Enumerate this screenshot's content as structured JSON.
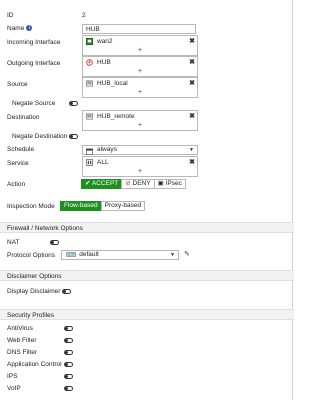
{
  "fields": {
    "id": {
      "label": "ID",
      "value": "2"
    },
    "name": {
      "label": "Name",
      "value": "HUB"
    },
    "incoming": {
      "label": "Incoming Interface",
      "items": [
        "wan2"
      ]
    },
    "outgoing": {
      "label": "Outgoing Interface",
      "items": [
        "HUB"
      ]
    },
    "source": {
      "label": "Source",
      "items": [
        "HUB_local"
      ]
    },
    "negate_source": {
      "label": "Negate Source"
    },
    "destination": {
      "label": "Destination",
      "items": [
        "HUB_remote"
      ]
    },
    "negate_destination": {
      "label": "Negate Destination"
    },
    "schedule": {
      "label": "Schedule",
      "value": "always"
    },
    "service": {
      "label": "Service",
      "items": [
        "ALL"
      ]
    },
    "action": {
      "label": "Action",
      "options": [
        "ACCEPT",
        "DENY",
        "IPsec"
      ],
      "selected": "ACCEPT"
    },
    "inspection_mode": {
      "label": "Inspection Mode",
      "options": [
        "Flow-based",
        "Proxy-based"
      ],
      "selected": "Flow-based"
    }
  },
  "firewall": {
    "title": "Firewall / Network Options",
    "nat": {
      "label": "NAT"
    },
    "protocol_options": {
      "label": "Protocol Options",
      "badge": "PRX",
      "value": "default"
    }
  },
  "disclaimer": {
    "title": "Disclaimer Options",
    "display_disclaimer": {
      "label": "Display Disclaimer"
    }
  },
  "security_profiles": {
    "title": "Security Profiles",
    "items": [
      "AntiVirus",
      "Web Filter",
      "DNS Filter",
      "Application Control",
      "IPS",
      "VoIP"
    ]
  },
  "colors": {
    "accent_green": "#1f8f1f",
    "info_blue": "#2a5db0",
    "remove_x": "#333333"
  }
}
